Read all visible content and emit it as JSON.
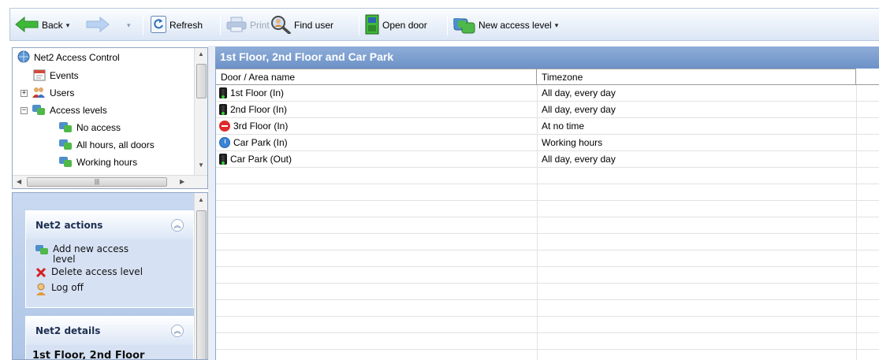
{
  "toolbar": {
    "back_label": "Back",
    "refresh_label": "Refresh",
    "print_label": "Print",
    "find_user_label": "Find user",
    "open_door_label": "Open door",
    "new_access_level_label": "New access level"
  },
  "tree": {
    "root": "Net2 Access Control",
    "items": [
      {
        "label": "Events"
      },
      {
        "label": "Users",
        "expander": "+"
      },
      {
        "label": "Access levels",
        "expander": "−"
      },
      {
        "label": "No access"
      },
      {
        "label": "All hours, all doors"
      },
      {
        "label": "Working hours"
      }
    ]
  },
  "actions": {
    "title": "Net2 actions",
    "items": [
      {
        "label": "Add new access level",
        "icon": "access-level-icon"
      },
      {
        "label": "Delete access level",
        "icon": "delete-icon"
      },
      {
        "label": "Log off",
        "icon": "user-logoff-icon"
      }
    ]
  },
  "details": {
    "title": "Net2 details",
    "text": "1st Floor, 2nd Floor"
  },
  "main": {
    "title": "1st Floor, 2nd Floor and Car Park",
    "columns": [
      "Door / Area name",
      "Timezone"
    ],
    "rows": [
      {
        "name": "1st Floor (In)",
        "timezone": "All day, every day",
        "icon": "traffic-light-icon"
      },
      {
        "name": "2nd Floor (In)",
        "timezone": "All day, every day",
        "icon": "traffic-light-icon"
      },
      {
        "name": "3rd Floor (In)",
        "timezone": "At no time",
        "icon": "no-entry-icon"
      },
      {
        "name": "Car Park (In)",
        "timezone": "Working hours",
        "icon": "clock-icon"
      },
      {
        "name": "Car Park (Out)",
        "timezone": "All day, every day",
        "icon": "traffic-light-icon"
      }
    ]
  },
  "colors": {
    "header_gradient_top": "#8eadd8",
    "header_gradient_bottom": "#6d92c8",
    "pane_blue": "#c9d9f0",
    "accent_green": "#3fb83a"
  }
}
